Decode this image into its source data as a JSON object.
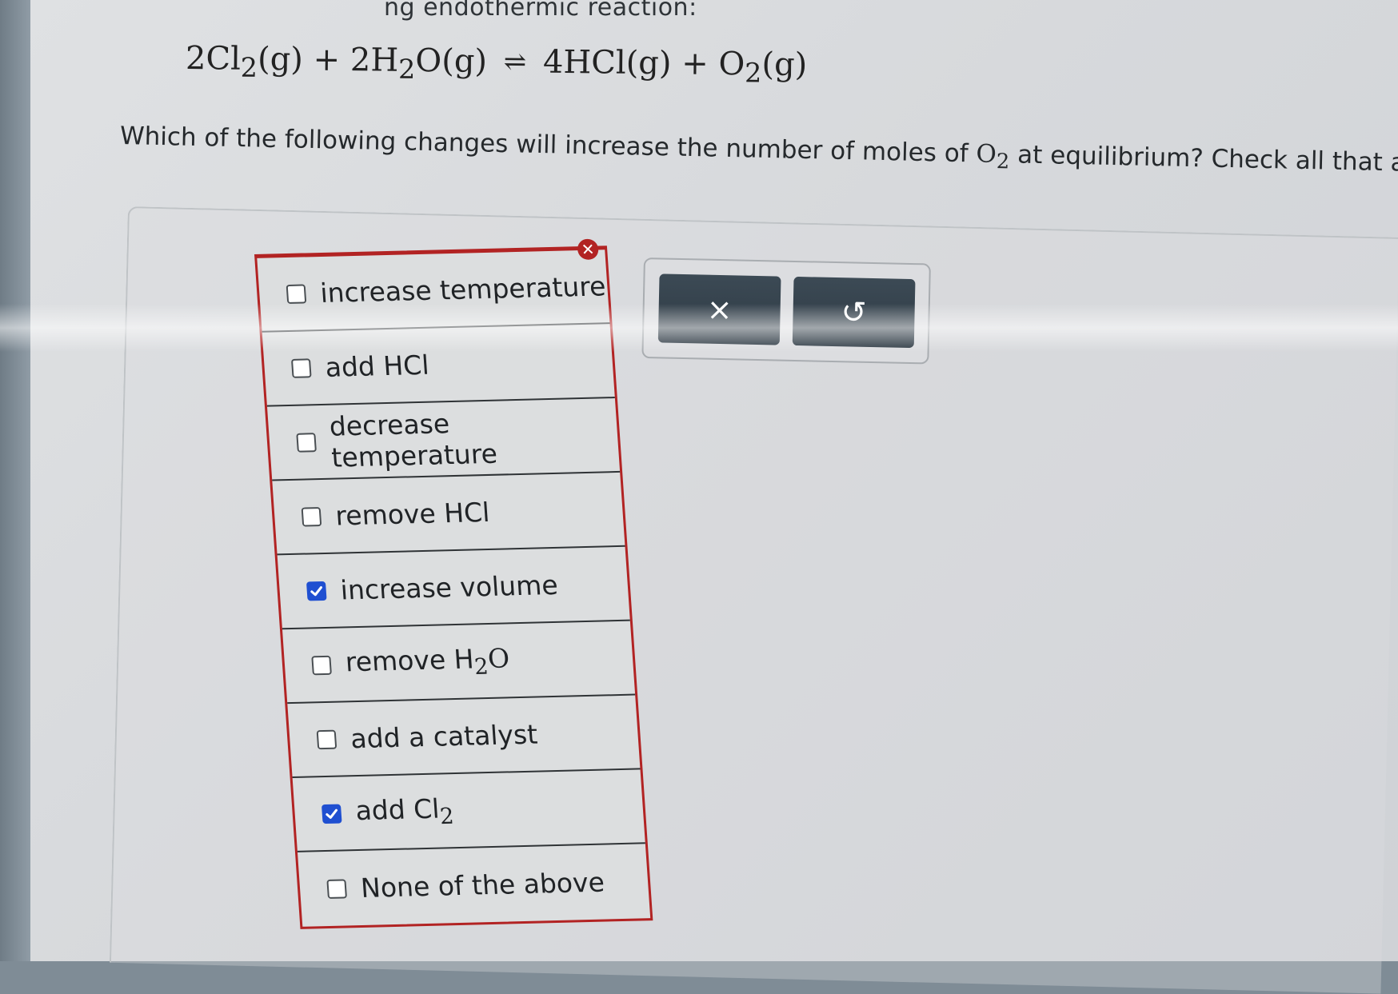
{
  "header": {
    "intro_fragment": "ng endothermic reaction:"
  },
  "equation": {
    "reactant1": "2Cl",
    "reactant1_sub": "2",
    "reactant1_state": "(g)",
    "plus1": "+",
    "reactant2_pre": "2H",
    "reactant2_sub": "2",
    "reactant2_post": "O(g)",
    "arrow": "⇌",
    "product1": "4HCl(g)",
    "plus2": "+",
    "product2": "O",
    "product2_sub": "2",
    "product2_state": "(g)"
  },
  "question": {
    "text_before": "Which of the following changes will increase the number of moles of ",
    "species": "O",
    "species_sub": "2",
    "text_after": " at equilibrium? Check all that apply."
  },
  "options": [
    {
      "label": "increase temperature",
      "checked": false
    },
    {
      "label": "add HCl",
      "checked": false
    },
    {
      "label": "decrease temperature",
      "checked": false
    },
    {
      "label": "remove HCl",
      "checked": false
    },
    {
      "label": "increase volume",
      "checked": true
    },
    {
      "label_pre": "remove H",
      "label_sub": "2",
      "label_post": "O",
      "checked": false
    },
    {
      "label": "add a catalyst",
      "checked": false
    },
    {
      "label_pre": "add Cl",
      "label_sub": "2",
      "checked": true
    },
    {
      "label": "None of the above",
      "checked": false
    }
  ],
  "toolbar": {
    "clear_icon": "×",
    "undo_icon": "↺"
  },
  "colors": {
    "highlight_border": "#b22323",
    "checkbox_checked": "#1f4fd1",
    "tool_button": "#34414c"
  }
}
